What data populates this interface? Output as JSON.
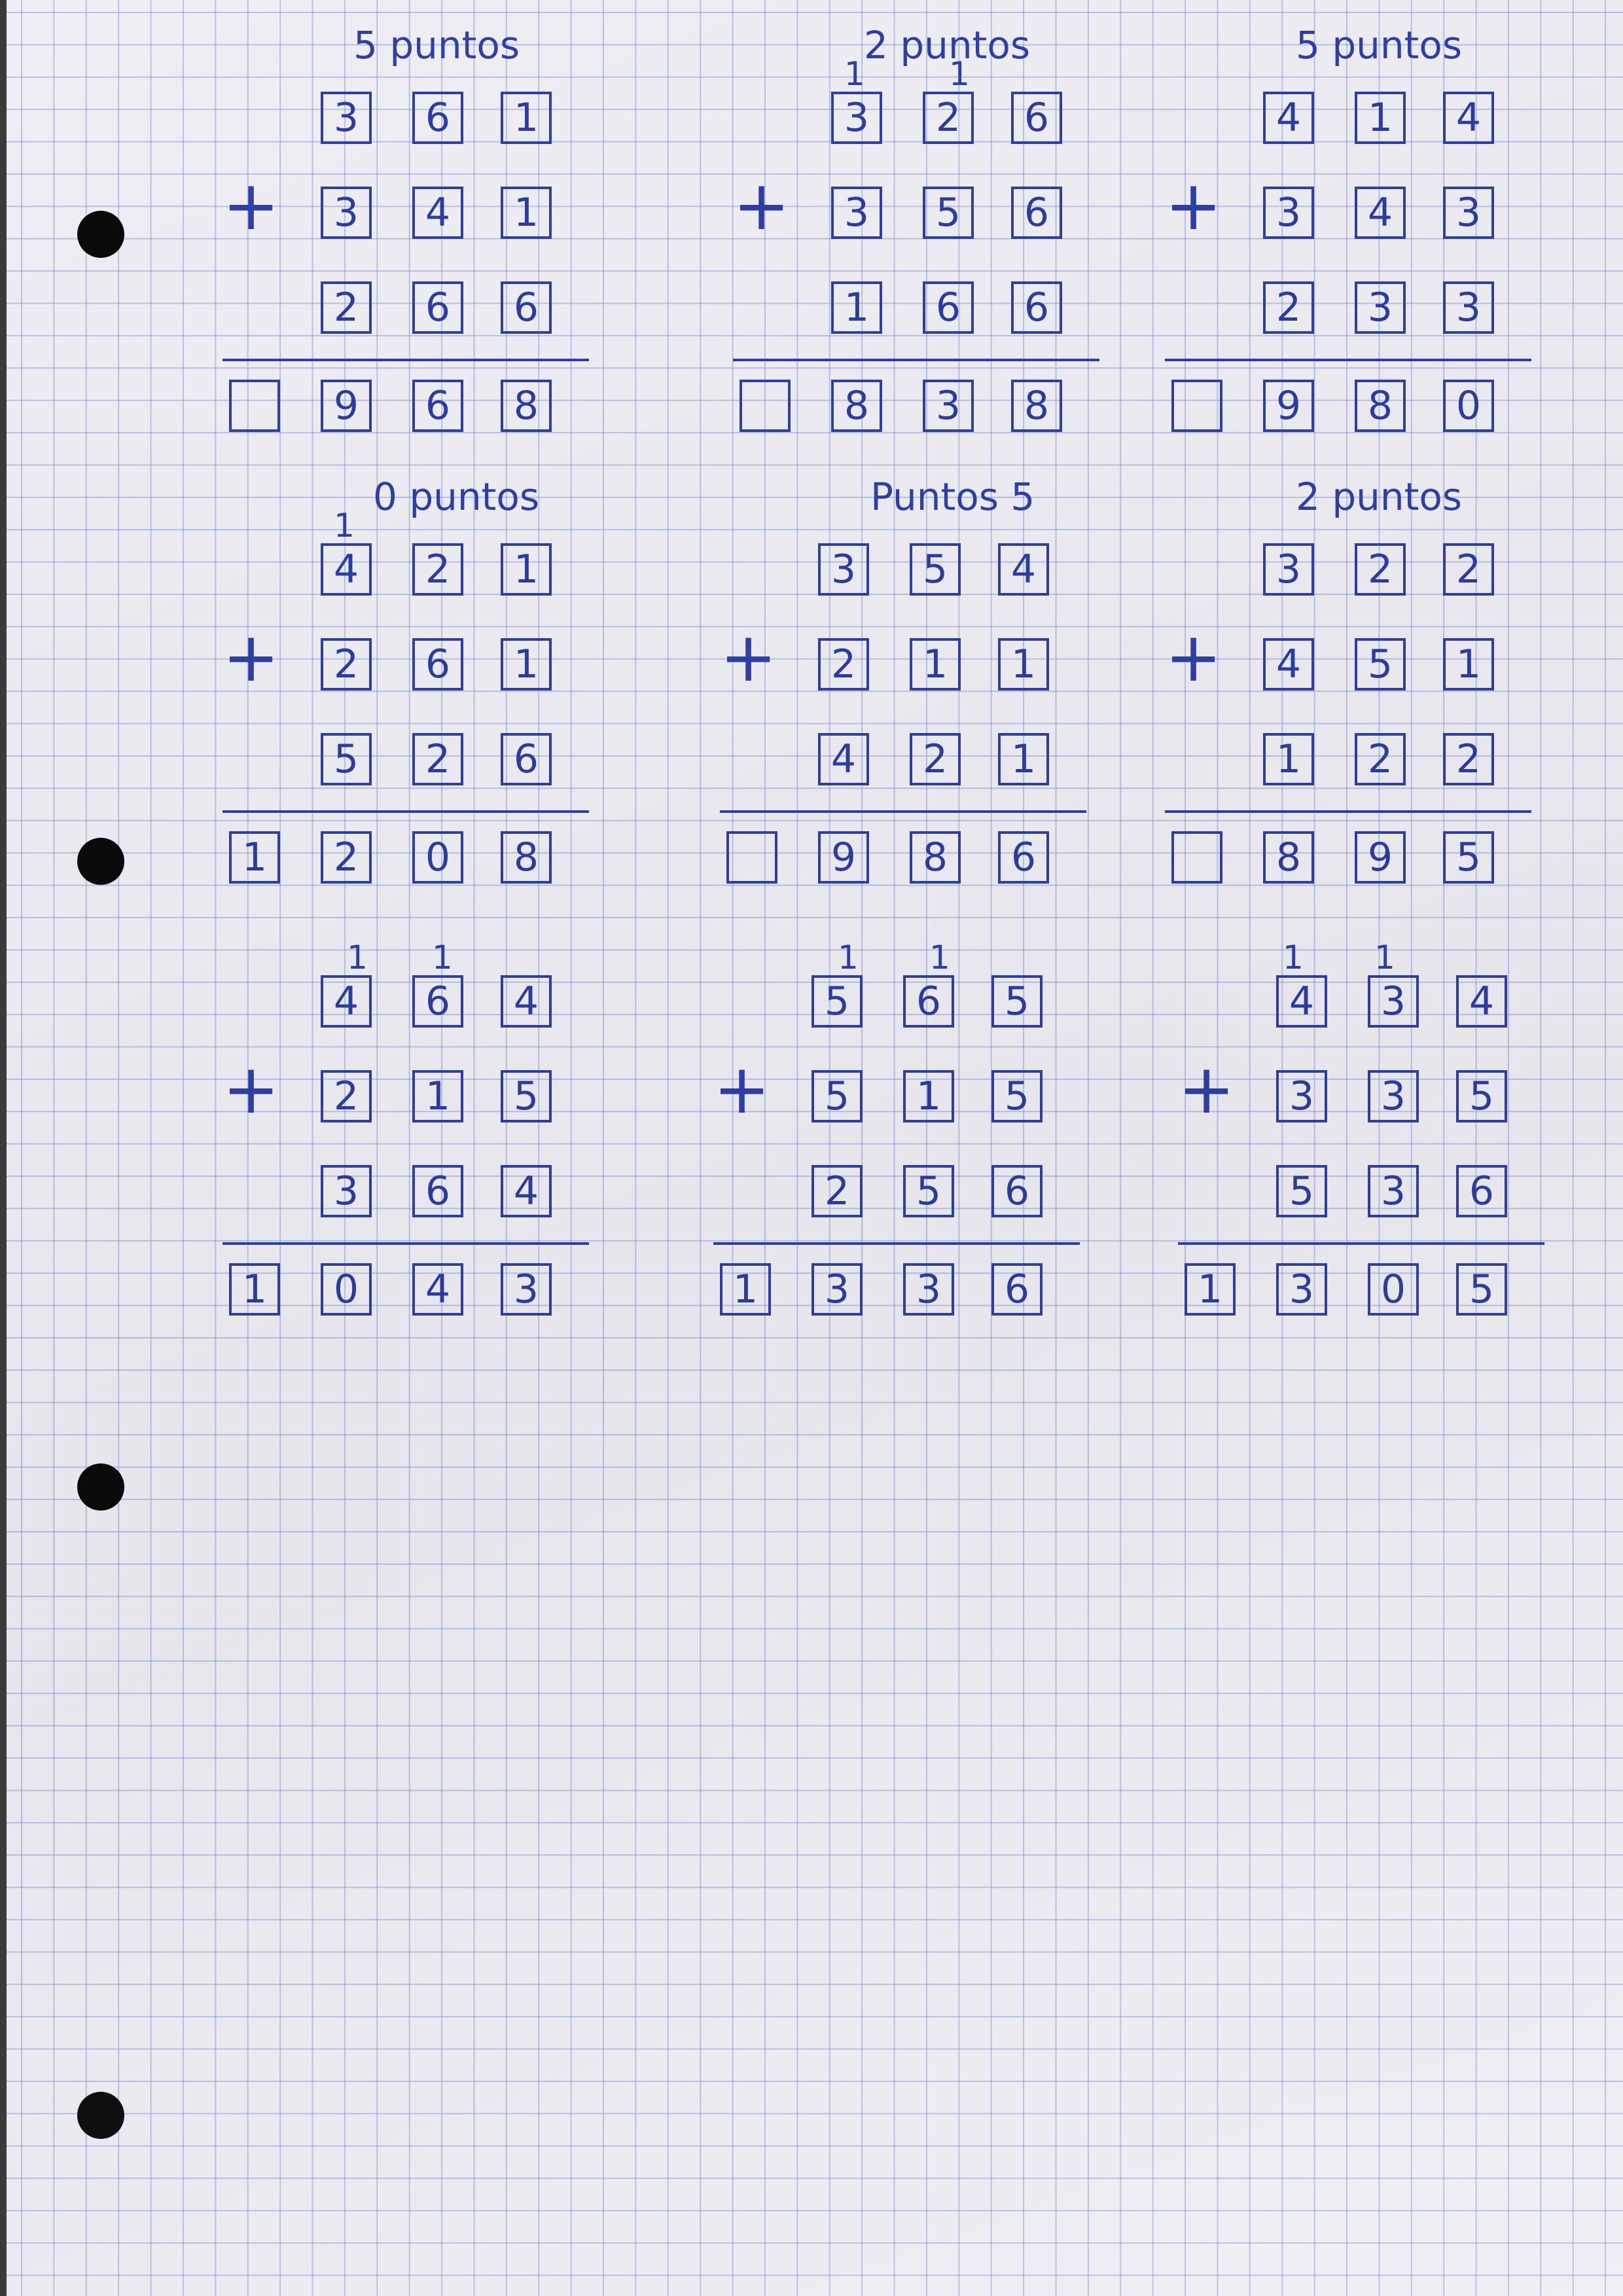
{
  "problems": [
    {
      "title": "5 puntos",
      "carries": [],
      "rows": [
        [
          "3",
          "6",
          "1"
        ],
        [
          "3",
          "4",
          "1"
        ],
        [
          "2",
          "6",
          "6"
        ]
      ],
      "operator": "+",
      "result": [
        "",
        "9",
        "6",
        "8"
      ]
    },
    {
      "title": "2 puntos",
      "carries": [
        "1",
        "1"
      ],
      "rows": [
        [
          "3",
          "2",
          "6"
        ],
        [
          "3",
          "5",
          "6"
        ],
        [
          "1",
          "6",
          "6"
        ]
      ],
      "operator": "+",
      "result": [
        "",
        "8",
        "3",
        "8"
      ]
    },
    {
      "title": "5 puntos",
      "carries": [],
      "rows": [
        [
          "4",
          "1",
          "4"
        ],
        [
          "3",
          "4",
          "3"
        ],
        [
          "2",
          "3",
          "3"
        ]
      ],
      "operator": "+",
      "result": [
        "",
        "9",
        "8",
        "0"
      ]
    },
    {
      "title": "0 puntos",
      "carries": [
        "1"
      ],
      "rows": [
        [
          "4",
          "2",
          "1"
        ],
        [
          "2",
          "6",
          "1"
        ],
        [
          "5",
          "2",
          "6"
        ]
      ],
      "operator": "+",
      "result": [
        "1",
        "2",
        "0",
        "8"
      ]
    },
    {
      "title": "Puntos 5",
      "carries": [],
      "rows": [
        [
          "3",
          "5",
          "4"
        ],
        [
          "2",
          "1",
          "1"
        ],
        [
          "4",
          "2",
          "1"
        ]
      ],
      "operator": "+",
      "result": [
        "",
        "9",
        "8",
        "6"
      ]
    },
    {
      "title": "2 puntos",
      "carries": [],
      "rows": [
        [
          "3",
          "2",
          "2"
        ],
        [
          "4",
          "5",
          "1"
        ],
        [
          "1",
          "2",
          "2"
        ]
      ],
      "operator": "+",
      "result": [
        "",
        "8",
        "9",
        "5"
      ]
    },
    {
      "title": "",
      "carries": [
        "1",
        "1"
      ],
      "rows": [
        [
          "4",
          "6",
          "4"
        ],
        [
          "2",
          "1",
          "5"
        ],
        [
          "3",
          "6",
          "4"
        ]
      ],
      "operator": "+",
      "result": [
        "1",
        "0",
        "4",
        "3"
      ]
    },
    {
      "title": "",
      "carries": [
        "1",
        "1"
      ],
      "rows": [
        [
          "5",
          "6",
          "5"
        ],
        [
          "5",
          "1",
          "5"
        ],
        [
          "2",
          "5",
          "6"
        ]
      ],
      "operator": "+",
      "result": [
        "1",
        "3",
        "3",
        "6"
      ]
    },
    {
      "title": "",
      "carries": [
        "1",
        "1"
      ],
      "rows": [
        [
          "4",
          "3",
          "4"
        ],
        [
          "3",
          "3",
          "5"
        ],
        [
          "5",
          "3",
          "6"
        ]
      ],
      "operator": "+",
      "result": [
        "1",
        "3",
        "0",
        "5"
      ]
    }
  ]
}
